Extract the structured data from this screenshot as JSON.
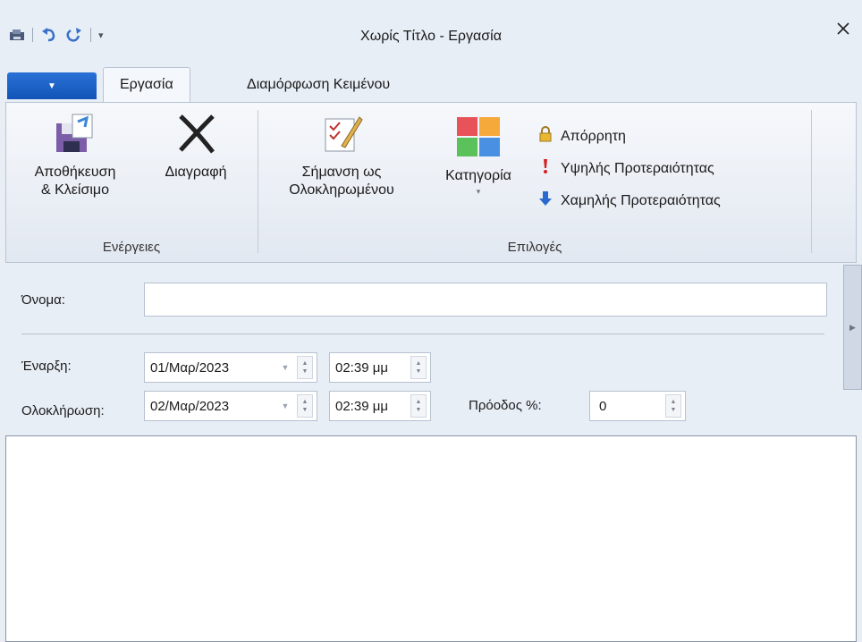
{
  "window": {
    "title": "Χωρίς Τίτλο - Εργασία",
    "close_icon": "close-icon"
  },
  "qat": {
    "icons": [
      "save-icon",
      "undo-icon",
      "redo-icon",
      "customize-qat-icon"
    ]
  },
  "tabs": [
    {
      "label": "Εργασία",
      "active": true
    },
    {
      "label": "Διαμόρφωση Κειμένου",
      "active": false
    }
  ],
  "ribbon": {
    "groups": {
      "actions": {
        "label": "Ενέργειες",
        "save_close": "Αποθήκευση\n& Κλείσιμο",
        "delete": "Διαγραφή"
      },
      "options": {
        "label": "Επιλογές",
        "mark_complete": "Σήμανση ως\nΟλοκληρωμένου",
        "category": "Κατηγορία",
        "private": "Απόρρητη",
        "high_priority": "Υψηλής Προτεραιότητας",
        "low_priority": "Χαμηλής Προτεραιότητας"
      }
    },
    "category_colors": [
      "#e8535a",
      "#f5a93a",
      "#5bc25b",
      "#4a90e2"
    ]
  },
  "form": {
    "name_label": "Όνομα:",
    "name_value": "",
    "start_label": "Έναρξη:",
    "start_date": "01/Μαρ/2023",
    "start_time": "02:39 μμ",
    "end_label": "Ολοκλήρωση:",
    "end_date": "02/Μαρ/2023",
    "end_time": "02:39 μμ",
    "progress_label": "Πρόοδος %:",
    "progress_value": "0"
  }
}
